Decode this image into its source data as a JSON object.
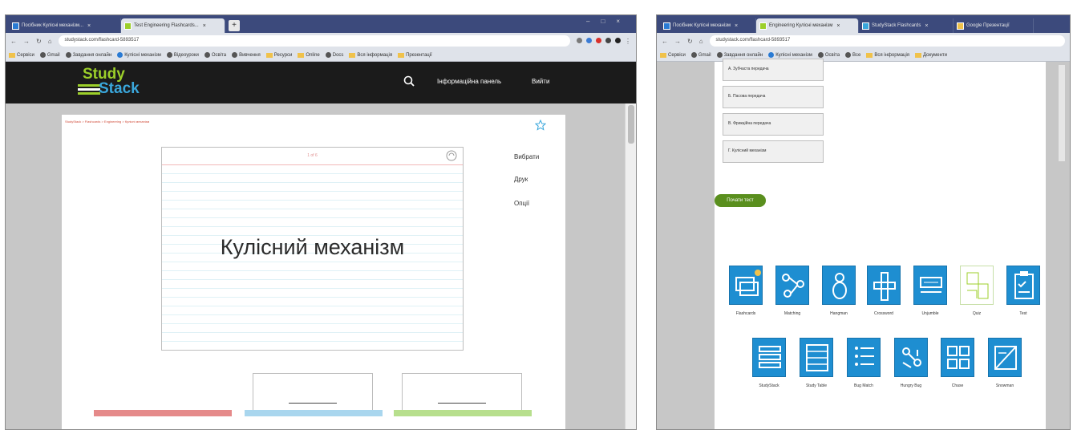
{
  "left_window": {
    "tabs": [
      {
        "label": "Посібник Кулісні механізм...",
        "active": false
      },
      {
        "label": "Test Engineering Flashcards...",
        "active": true
      }
    ],
    "url": "studystack.com/flashcard-5893517",
    "bookmarks": [
      "Сервіси",
      "Gmail",
      "Завдання онлайн",
      "Кулісні механізм",
      "Відеоуроки",
      "Освіта",
      "Вивчення",
      "Ресурси",
      "Online",
      "Docs",
      "Вся інформація",
      "Презентації"
    ],
    "site": {
      "logo_top": "Study",
      "logo_bottom": "Stack",
      "nav": [
        "Інформаційна панель",
        "Вийти"
      ],
      "breadcrumb": "StudyStack > Flashcards > Engineering > Кулісні механізм",
      "side_links": [
        "Вибрати",
        "Друк",
        "Опції"
      ],
      "card_number": "1 of 6",
      "card_text": "Кулісний механізм"
    }
  },
  "right_window": {
    "tabs": [
      {
        "label": "Посібник Кулісні механізм",
        "active": false
      },
      {
        "label": "Engineering Кулісні механізм",
        "active": true
      },
      {
        "label": "StudyStack Flashcards",
        "active": false
      },
      {
        "label": "Google Презентації",
        "active": false
      }
    ],
    "url": "studystack.com/flashcard-5893517",
    "bookmarks": [
      "Сервіси",
      "Gmail",
      "Завдання онлайн",
      "Кулісні механізм",
      "Освіта",
      "Все",
      "Вся інформація",
      "Документи"
    ],
    "answers": [
      "А. Зубчаста передача",
      "Б. Пасова передача",
      "В. Фрикційна передача",
      "Г. Кулісний механізм"
    ],
    "start_button": "Почати тест",
    "activities_row1": [
      "Flashcards",
      "Matching",
      "Hangman",
      "Crossword",
      "Unjumble",
      "Quiz",
      "Test"
    ],
    "activities_row2": [
      "StudyStack",
      "Study Table",
      "Bug Match",
      "Hungry Bug",
      "Chase",
      "Snowman"
    ]
  },
  "colors": {
    "tabbar": "#3c4a7c",
    "nav_bg": "#1b1b1b",
    "logo_green": "#9ccf2a",
    "logo_blue": "#3aa7dc",
    "tile_blue": "#1e8ed1",
    "start_green": "#5a8f1e"
  }
}
